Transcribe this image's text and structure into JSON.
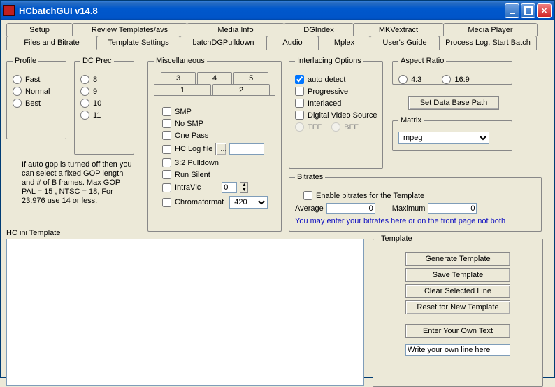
{
  "title": "HCbatchGUI v14.8",
  "tabs_top": [
    "Setup",
    "Review Templates/avs",
    "Media Info",
    "DGIndex",
    "MKVextract",
    "Media Player"
  ],
  "tabs_bottom": [
    "Files and Bitrate",
    "Template Settings",
    "batchDGPulldown",
    "Audio",
    "Mplex",
    "User's Guide",
    "Process Log, Start Batch"
  ],
  "active_tab": "Template Settings",
  "profile": {
    "legend": "Profile",
    "options": [
      "Fast",
      "Normal",
      "Best"
    ]
  },
  "dcprec": {
    "legend": "DC Prec",
    "options": [
      "8",
      "9",
      "10",
      "11"
    ]
  },
  "gop_note": "If auto gop is turned off then you can select a fixed GOP length and # of B frames.   Max GOP       PAL = 15 , NTSC = 18,            For 23.976 use 14 or less.",
  "misc": {
    "legend": "Miscellaneous",
    "sub_top": [
      "3",
      "4",
      "5"
    ],
    "sub_bot": [
      "1",
      "2"
    ],
    "smp": "SMP",
    "nosmp": "No SMP",
    "onepass": "One Pass",
    "hclog": "HC Log file",
    "hclog_btn": "...",
    "pulldown": "3:2 Pulldown",
    "runsilent": "Run Silent",
    "intravlc": "IntraVlc",
    "intravlc_val": "0",
    "chroma": "Chromaformat",
    "chroma_val": "420"
  },
  "interlacing": {
    "legend": "Interlacing Options",
    "auto": "auto detect",
    "prog": "Progressive",
    "inter": "Interlaced",
    "dvs": "Digital Video Source",
    "tff": "TFF",
    "bff": "BFF"
  },
  "aspect": {
    "legend": "Aspect Ratio",
    "r43": "4:3",
    "r169": "16:9"
  },
  "dbpath_btn": "Set Data Base Path",
  "matrix": {
    "legend": "Matrix",
    "value": "mpeg"
  },
  "bitrates": {
    "legend": "Bitrates",
    "enable": "Enable bitrates for the Template",
    "avg": "Average",
    "avg_val": "0",
    "max": "Maximum",
    "max_val": "0",
    "note": "You may enter your bitrates here or on the front page not both"
  },
  "template": {
    "legend": "Template",
    "gen": "Generate Template",
    "save": "Save Template",
    "clear": "Clear Selected Line",
    "reset": "Reset for New Template",
    "own": "Enter Your Own Text",
    "own_val": "Write your own line here"
  },
  "ini_legend": "HC ini Template"
}
